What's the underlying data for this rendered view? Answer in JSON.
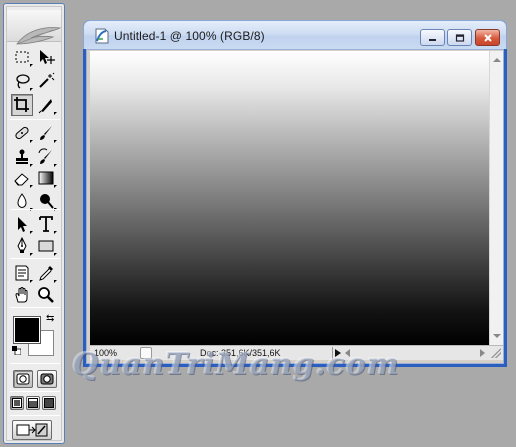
{
  "document": {
    "title": "Untitled-1 @ 100% (RGB/8)",
    "zoom": "100%",
    "doc_info": "Doc: 351,6K/351,6K"
  },
  "colors": {
    "foreground": "#000000",
    "background": "#ffffff",
    "titlebar_top": "#e4eefb",
    "close_button": "#d8593c"
  },
  "tools": [
    "rectangular-marquee-icon",
    "move-icon",
    "lasso-icon",
    "magic-wand-icon",
    "crop-icon",
    "slice-icon",
    "healing-brush-icon",
    "brush-icon",
    "clone-stamp-icon",
    "history-brush-icon",
    "eraser-icon",
    "gradient-icon",
    "blur-icon",
    "dodge-icon",
    "path-selection-icon",
    "type-icon",
    "pen-icon",
    "rectangle-shape-icon",
    "notes-icon",
    "eyedropper-icon",
    "hand-icon",
    "zoom-icon"
  ],
  "watermark": "QuanTriMang.com"
}
